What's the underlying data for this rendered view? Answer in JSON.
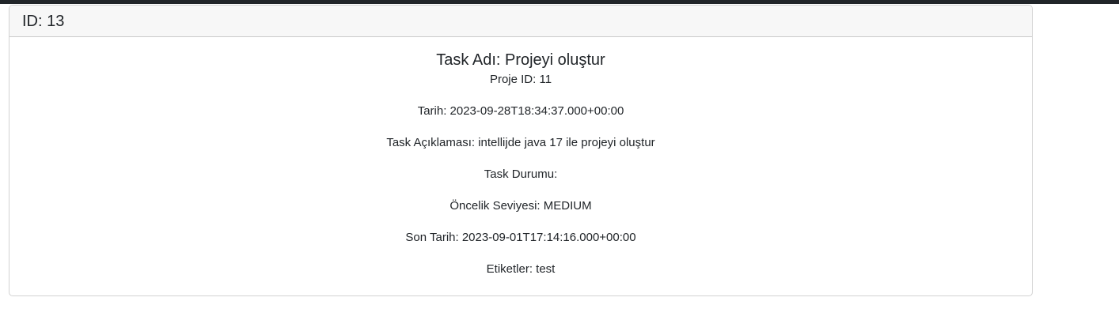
{
  "header": {
    "id_label": "ID: 13"
  },
  "task": {
    "title": "Task Adı: Projeyi oluştur",
    "fields": [
      "Proje ID: 11",
      "Tarih: 2023-09-28T18:34:37.000+00:00",
      "Task Açıklaması: intellijde java 17 ile projeyi oluştur",
      "Task Durumu:",
      "Öncelik Seviyesi: MEDIUM",
      "Son Tarih: 2023-09-01T17:14:16.000+00:00",
      "Etiketler: test"
    ]
  }
}
